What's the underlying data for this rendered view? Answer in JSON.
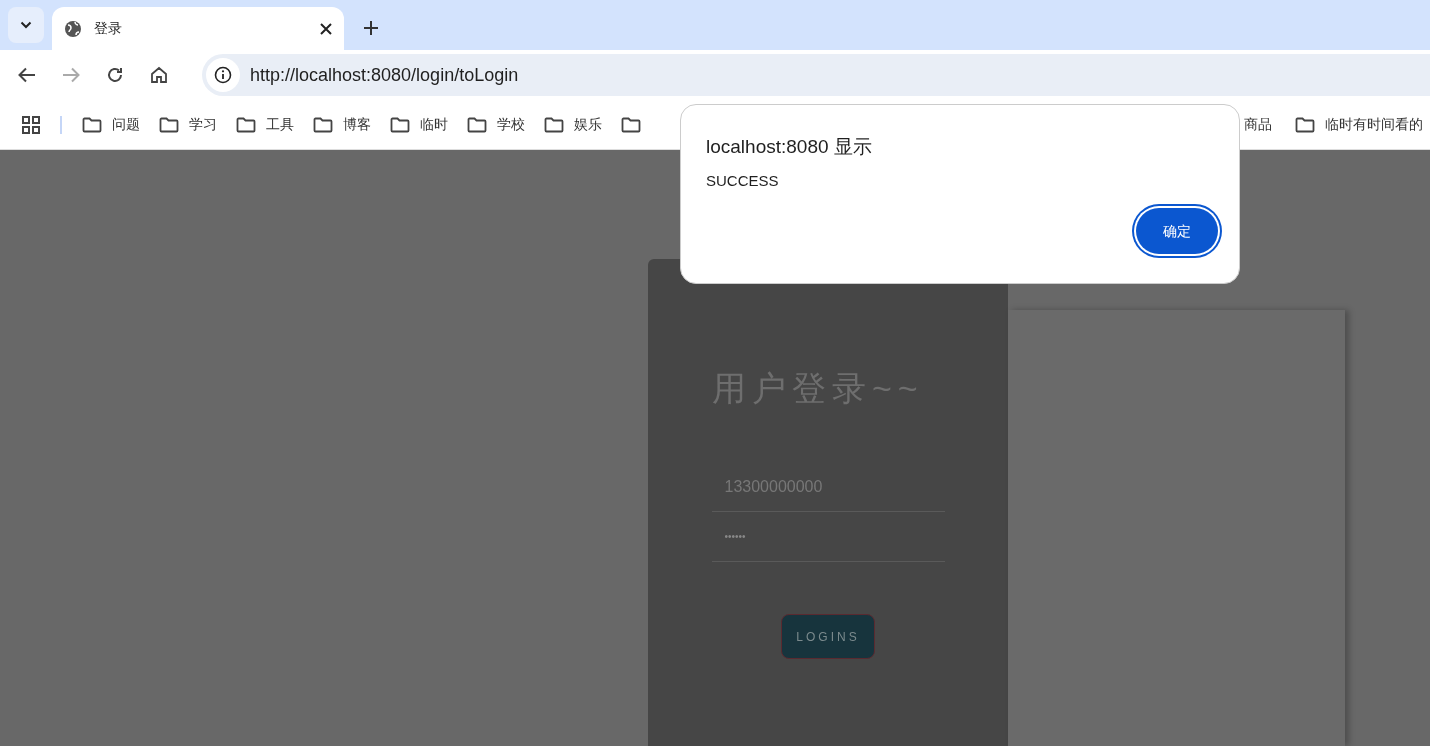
{
  "tabs": [
    {
      "title": "登录",
      "selected": true
    }
  ],
  "address_bar": {
    "url": "http://localhost:8080/login/toLogin"
  },
  "bookmarks": [
    {
      "kind": "folder",
      "label": "问题"
    },
    {
      "kind": "folder",
      "label": "学习"
    },
    {
      "kind": "folder",
      "label": "工具"
    },
    {
      "kind": "folder",
      "label": "博客"
    },
    {
      "kind": "folder",
      "label": "临时"
    },
    {
      "kind": "folder",
      "label": "学校"
    },
    {
      "kind": "folder",
      "label": "娱乐"
    },
    {
      "kind": "icon"
    },
    {
      "kind": "gap"
    },
    {
      "kind": "label",
      "label": "商品"
    },
    {
      "kind": "folder",
      "label": "临时有时间看的"
    }
  ],
  "login": {
    "title": "用户登录~~",
    "username": "13300000000",
    "password": "••••••",
    "button": "LOGINS"
  },
  "dialog": {
    "title": "localhost:8080 显示",
    "message": "SUCCESS",
    "ok": "确定"
  }
}
